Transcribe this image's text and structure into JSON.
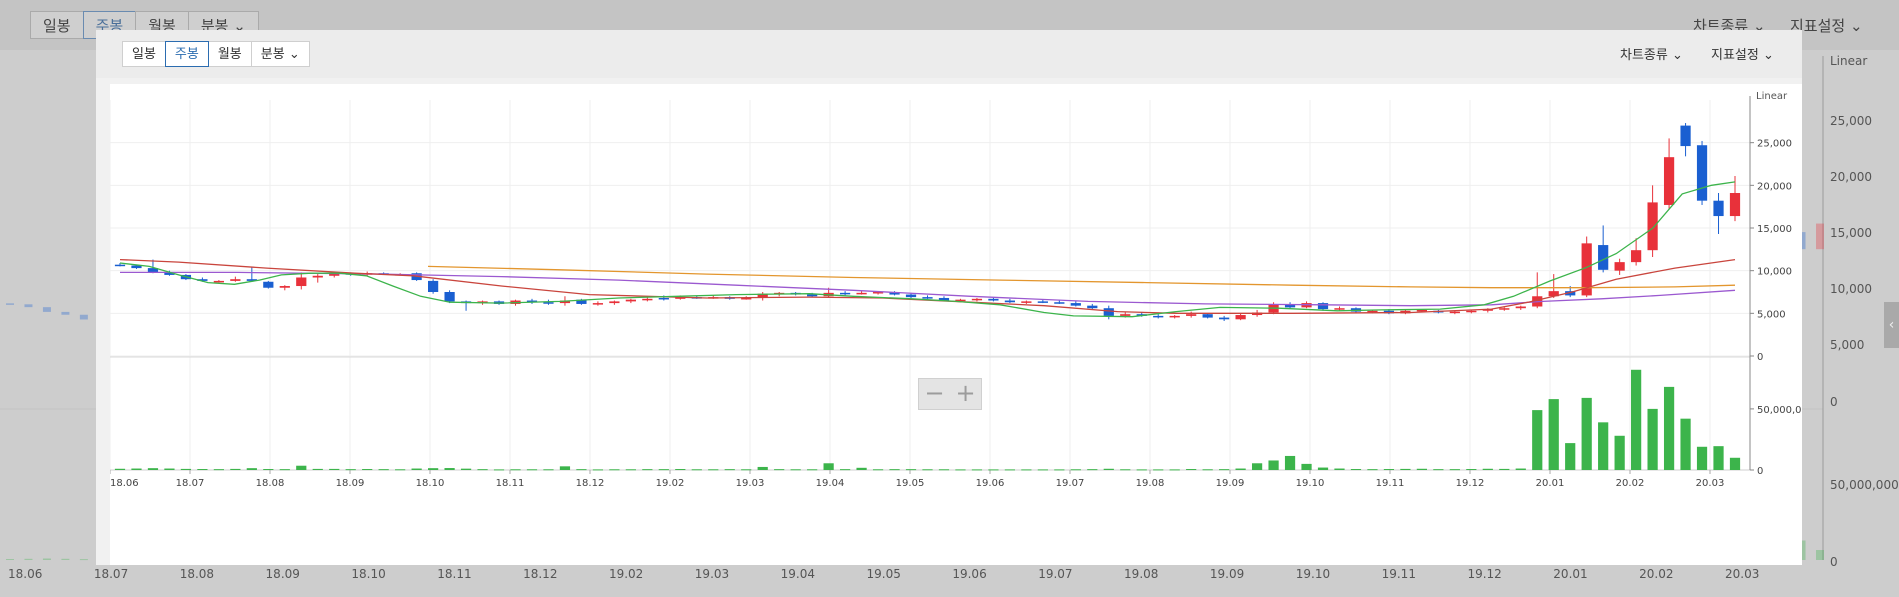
{
  "background": {
    "tabs": [
      "일봉",
      "주봉",
      "월봉",
      "분봉"
    ],
    "active_tab": 1,
    "chart_type_label": "차트종류",
    "indicator_label": "지표설정",
    "scale_label": "Linear",
    "price_ticks": [
      "25,000",
      "20,000",
      "15,000",
      "10,000",
      "5,000",
      "0"
    ],
    "volume_ticks": [
      "50,000,000",
      "0"
    ],
    "x_ticks": [
      "18.06",
      "18.07",
      "18.08",
      "18.09",
      "18.10",
      "18.11",
      "18.12",
      "19.02",
      "19.03",
      "19.04",
      "19.05",
      "19.06",
      "19.07",
      "19.08",
      "19.09",
      "19.10",
      "19.11",
      "19.12",
      "20.01",
      "20.02",
      "20.03"
    ]
  },
  "toolbar": {
    "tabs": [
      "일봉",
      "주봉",
      "월봉",
      "분봉"
    ],
    "active_tab": 1,
    "chart_type_label": "차트종류",
    "indicator_label": "지표설정"
  },
  "zoom": {
    "minus": "−",
    "plus": "+"
  },
  "chart_data": {
    "type": "candlestick",
    "scale": "Linear",
    "x_ticks": [
      "18.06",
      "18.07",
      "18.08",
      "18.09",
      "18.10",
      "18.11",
      "18.12",
      "19.02",
      "19.03",
      "19.04",
      "19.05",
      "19.06",
      "19.07",
      "19.08",
      "19.09",
      "19.10",
      "19.11",
      "19.12",
      "20.01",
      "20.02",
      "20.03"
    ],
    "price_axis": {
      "ylim": [
        0,
        30000
      ],
      "ticks": [
        0,
        5000,
        10000,
        15000,
        20000,
        25000
      ],
      "tick_labels": [
        "0",
        "5,000",
        "10,000",
        "15,000",
        "20,000",
        "25,000"
      ]
    },
    "volume_axis": {
      "ylim": [
        0,
        90000000
      ],
      "ticks": [
        0,
        50000000
      ],
      "tick_labels": [
        "0",
        "50,000,000"
      ]
    },
    "colors": {
      "up": "#e8313a",
      "down": "#1a5fd1",
      "volume": "#3cb44b",
      "ma5": "#3cb44b",
      "ma20": "#c9453d",
      "ma60": "#9b59d0",
      "ma120": "#e3962e"
    },
    "candles": [
      [
        10700,
        10900,
        10500,
        10600,
        1000000
      ],
      [
        10600,
        10700,
        10200,
        10300,
        1200000
      ],
      [
        10300,
        11300,
        9700,
        9800,
        1500000
      ],
      [
        9800,
        10000,
        9400,
        9500,
        1200000
      ],
      [
        9500,
        9600,
        8900,
        9000,
        900000
      ],
      [
        9000,
        9200,
        8700,
        8800,
        800000
      ],
      [
        8800,
        8900,
        8600,
        8800,
        700000
      ],
      [
        8800,
        9300,
        8700,
        9000,
        900000
      ],
      [
        9000,
        10400,
        8700,
        8800,
        1500000
      ],
      [
        8700,
        8800,
        7900,
        8000,
        800000
      ],
      [
        8000,
        8300,
        7700,
        8200,
        700000
      ],
      [
        8200,
        9800,
        7800,
        9200,
        3500000
      ],
      [
        9200,
        9600,
        8600,
        9400,
        900000
      ],
      [
        9400,
        9900,
        9200,
        9700,
        900000
      ],
      [
        9700,
        9800,
        9400,
        9600,
        700000
      ],
      [
        9600,
        9900,
        9400,
        9700,
        800000
      ],
      [
        9700,
        9800,
        9500,
        9600,
        700000
      ],
      [
        9600,
        9700,
        9500,
        9600,
        600000
      ],
      [
        9700,
        9800,
        8800,
        8900,
        1200000
      ],
      [
        8800,
        9000,
        7300,
        7500,
        1500000
      ],
      [
        7500,
        7700,
        6200,
        6400,
        1600000
      ],
      [
        6400,
        6500,
        5300,
        6200,
        1100000
      ],
      [
        6200,
        6500,
        6000,
        6400,
        700000
      ],
      [
        6400,
        6500,
        6000,
        6100,
        500000
      ],
      [
        6100,
        6600,
        5900,
        6500,
        600000
      ],
      [
        6500,
        6700,
        6100,
        6300,
        600000
      ],
      [
        6300,
        6600,
        6000,
        6200,
        600000
      ],
      [
        6200,
        7000,
        5900,
        6500,
        3000000
      ],
      [
        6600,
        6700,
        6000,
        6100,
        700000
      ],
      [
        6100,
        6400,
        5900,
        6200,
        500000
      ],
      [
        6200,
        6500,
        6000,
        6400,
        600000
      ],
      [
        6400,
        6700,
        6200,
        6600,
        600000
      ],
      [
        6600,
        6900,
        6400,
        6700,
        700000
      ],
      [
        6800,
        7100,
        6500,
        6700,
        700000
      ],
      [
        6700,
        7100,
        6600,
        6900,
        800000
      ],
      [
        6900,
        7000,
        6700,
        6800,
        600000
      ],
      [
        6800,
        7100,
        6700,
        6900,
        600000
      ],
      [
        6900,
        7000,
        6600,
        6700,
        700000
      ],
      [
        6700,
        7000,
        6600,
        6800,
        600000
      ],
      [
        6800,
        7500,
        6500,
        7300,
        2500000
      ],
      [
        7300,
        7500,
        7000,
        7400,
        700000
      ],
      [
        7400,
        7500,
        7100,
        7200,
        600000
      ],
      [
        7200,
        7400,
        6900,
        7000,
        600000
      ],
      [
        7000,
        8000,
        6800,
        7400,
        5500000
      ],
      [
        7400,
        7600,
        7100,
        7300,
        700000
      ],
      [
        7300,
        7600,
        7200,
        7400,
        1800000
      ],
      [
        7400,
        7600,
        7200,
        7500,
        600000
      ],
      [
        7500,
        7600,
        7100,
        7200,
        700000
      ],
      [
        7200,
        7400,
        6800,
        6900,
        700000
      ],
      [
        6900,
        7100,
        6700,
        6800,
        600000
      ],
      [
        6800,
        7000,
        6400,
        6500,
        600000
      ],
      [
        6500,
        6700,
        6300,
        6600,
        500000
      ],
      [
        6600,
        6800,
        6400,
        6700,
        500000
      ],
      [
        6700,
        6800,
        6400,
        6500,
        500000
      ],
      [
        6500,
        6700,
        6200,
        6300,
        500000
      ],
      [
        6300,
        6500,
        6100,
        6400,
        500000
      ],
      [
        6400,
        6600,
        6200,
        6300,
        500000
      ],
      [
        6300,
        6500,
        6100,
        6200,
        500000
      ],
      [
        6200,
        6400,
        5800,
        5900,
        600000
      ],
      [
        5900,
        6100,
        5500,
        5600,
        700000
      ],
      [
        5600,
        5900,
        4300,
        4700,
        1000000
      ],
      [
        4700,
        5100,
        4500,
        4900,
        600000
      ],
      [
        4900,
        5100,
        4600,
        4700,
        500000
      ],
      [
        4700,
        4900,
        4400,
        4600,
        500000
      ],
      [
        4600,
        4800,
        4400,
        4700,
        500000
      ],
      [
        4700,
        5200,
        4500,
        4900,
        800000
      ],
      [
        4900,
        5000,
        4400,
        4500,
        600000
      ],
      [
        4500,
        4700,
        4100,
        4300,
        700000
      ],
      [
        4300,
        5000,
        4200,
        4800,
        1200000
      ],
      [
        4800,
        5400,
        4600,
        5100,
        5500000
      ],
      [
        5100,
        6300,
        4900,
        6000,
        7800000
      ],
      [
        6000,
        6300,
        5600,
        5700,
        11500000
      ],
      [
        5700,
        6400,
        5600,
        6200,
        5000000
      ],
      [
        6200,
        6300,
        5300,
        5500,
        2000000
      ],
      [
        5500,
        5800,
        5300,
        5600,
        1200000
      ],
      [
        5600,
        5700,
        5100,
        5200,
        800000
      ],
      [
        5200,
        5400,
        5000,
        5300,
        700000
      ],
      [
        5300,
        5500,
        4900,
        5000,
        800000
      ],
      [
        5000,
        5400,
        4900,
        5300,
        900000
      ],
      [
        5300,
        5500,
        5100,
        5400,
        1000000
      ],
      [
        5300,
        5400,
        5000,
        5100,
        700000
      ],
      [
        5100,
        5300,
        4900,
        5200,
        700000
      ],
      [
        5200,
        5400,
        5000,
        5300,
        800000
      ],
      [
        5300,
        5600,
        5100,
        5500,
        1000000
      ],
      [
        5500,
        5700,
        5300,
        5600,
        900000
      ],
      [
        5600,
        5900,
        5400,
        5800,
        1200000
      ],
      [
        5800,
        9800,
        5600,
        7000,
        49000000
      ],
      [
        7000,
        9600,
        6800,
        7600,
        58000000
      ],
      [
        7600,
        8200,
        6900,
        7100,
        22000000
      ],
      [
        7100,
        14000,
        6900,
        13200,
        59000000
      ],
      [
        13000,
        15300,
        9800,
        10100,
        39000000
      ],
      [
        10000,
        11400,
        9500,
        11000,
        28000000
      ],
      [
        11000,
        13800,
        10600,
        12400,
        82000000
      ],
      [
        12400,
        20000,
        11600,
        18000,
        50000000
      ],
      [
        17700,
        25500,
        17200,
        23300,
        68000000
      ],
      [
        27000,
        27300,
        23400,
        24600,
        42000000
      ],
      [
        24700,
        25200,
        17700,
        18200,
        19000000
      ],
      [
        18200,
        19100,
        14300,
        16400,
        19500000
      ],
      [
        16400,
        21100,
        15800,
        19100,
        10000000
      ]
    ],
    "ma5": [
      [
        0,
        10900
      ],
      [
        20,
        10500
      ],
      [
        40,
        9500
      ],
      [
        60,
        8600
      ],
      [
        78,
        8400
      ],
      [
        95,
        8900
      ],
      [
        110,
        9500
      ],
      [
        130,
        9700
      ],
      [
        150,
        9700
      ],
      [
        168,
        9400
      ],
      [
        186,
        8200
      ],
      [
        205,
        7000
      ],
      [
        225,
        6300
      ],
      [
        260,
        6200
      ],
      [
        300,
        6400
      ],
      [
        340,
        6800
      ],
      [
        380,
        7000
      ],
      [
        420,
        7200
      ],
      [
        470,
        7300
      ],
      [
        500,
        7000
      ],
      [
        540,
        6700
      ],
      [
        570,
        6400
      ],
      [
        600,
        6000
      ],
      [
        630,
        5100
      ],
      [
        650,
        4700
      ],
      [
        690,
        4600
      ],
      [
        720,
        5200
      ],
      [
        750,
        5700
      ],
      [
        790,
        5600
      ],
      [
        830,
        5300
      ],
      [
        860,
        5400
      ],
      [
        900,
        5500
      ],
      [
        930,
        6000
      ],
      [
        950,
        7000
      ],
      [
        975,
        8800
      ],
      [
        1000,
        10400
      ],
      [
        1020,
        12000
      ],
      [
        1045,
        15000
      ],
      [
        1065,
        19000
      ],
      [
        1085,
        20000
      ],
      [
        1101,
        20400
      ]
    ],
    "ma20": [
      [
        0,
        11300
      ],
      [
        40,
        11000
      ],
      [
        100,
        10300
      ],
      [
        160,
        9700
      ],
      [
        200,
        9400
      ],
      [
        260,
        8200
      ],
      [
        320,
        7200
      ],
      [
        400,
        6800
      ],
      [
        470,
        6900
      ],
      [
        520,
        6800
      ],
      [
        580,
        6300
      ],
      [
        630,
        5900
      ],
      [
        680,
        5200
      ],
      [
        720,
        5000
      ],
      [
        800,
        5000
      ],
      [
        880,
        5100
      ],
      [
        935,
        5500
      ],
      [
        960,
        6300
      ],
      [
        990,
        7500
      ],
      [
        1020,
        9000
      ],
      [
        1060,
        10300
      ],
      [
        1101,
        11300
      ]
    ],
    "ma60": [
      [
        0,
        9800
      ],
      [
        80,
        9800
      ],
      [
        180,
        9600
      ],
      [
        260,
        9300
      ],
      [
        340,
        8900
      ],
      [
        420,
        8300
      ],
      [
        500,
        7700
      ],
      [
        580,
        7000
      ],
      [
        660,
        6400
      ],
      [
        740,
        6100
      ],
      [
        820,
        6000
      ],
      [
        880,
        5900
      ],
      [
        935,
        6000
      ],
      [
        970,
        6400
      ],
      [
        1010,
        6700
      ],
      [
        1050,
        7100
      ],
      [
        1101,
        7700
      ]
    ],
    "ma120": [
      [
        210,
        10500
      ],
      [
        300,
        10100
      ],
      [
        400,
        9600
      ],
      [
        500,
        9200
      ],
      [
        600,
        8900
      ],
      [
        700,
        8600
      ],
      [
        800,
        8300
      ],
      [
        880,
        8100
      ],
      [
        935,
        8000
      ],
      [
        1000,
        8000
      ],
      [
        1060,
        8100
      ],
      [
        1101,
        8300
      ]
    ]
  }
}
